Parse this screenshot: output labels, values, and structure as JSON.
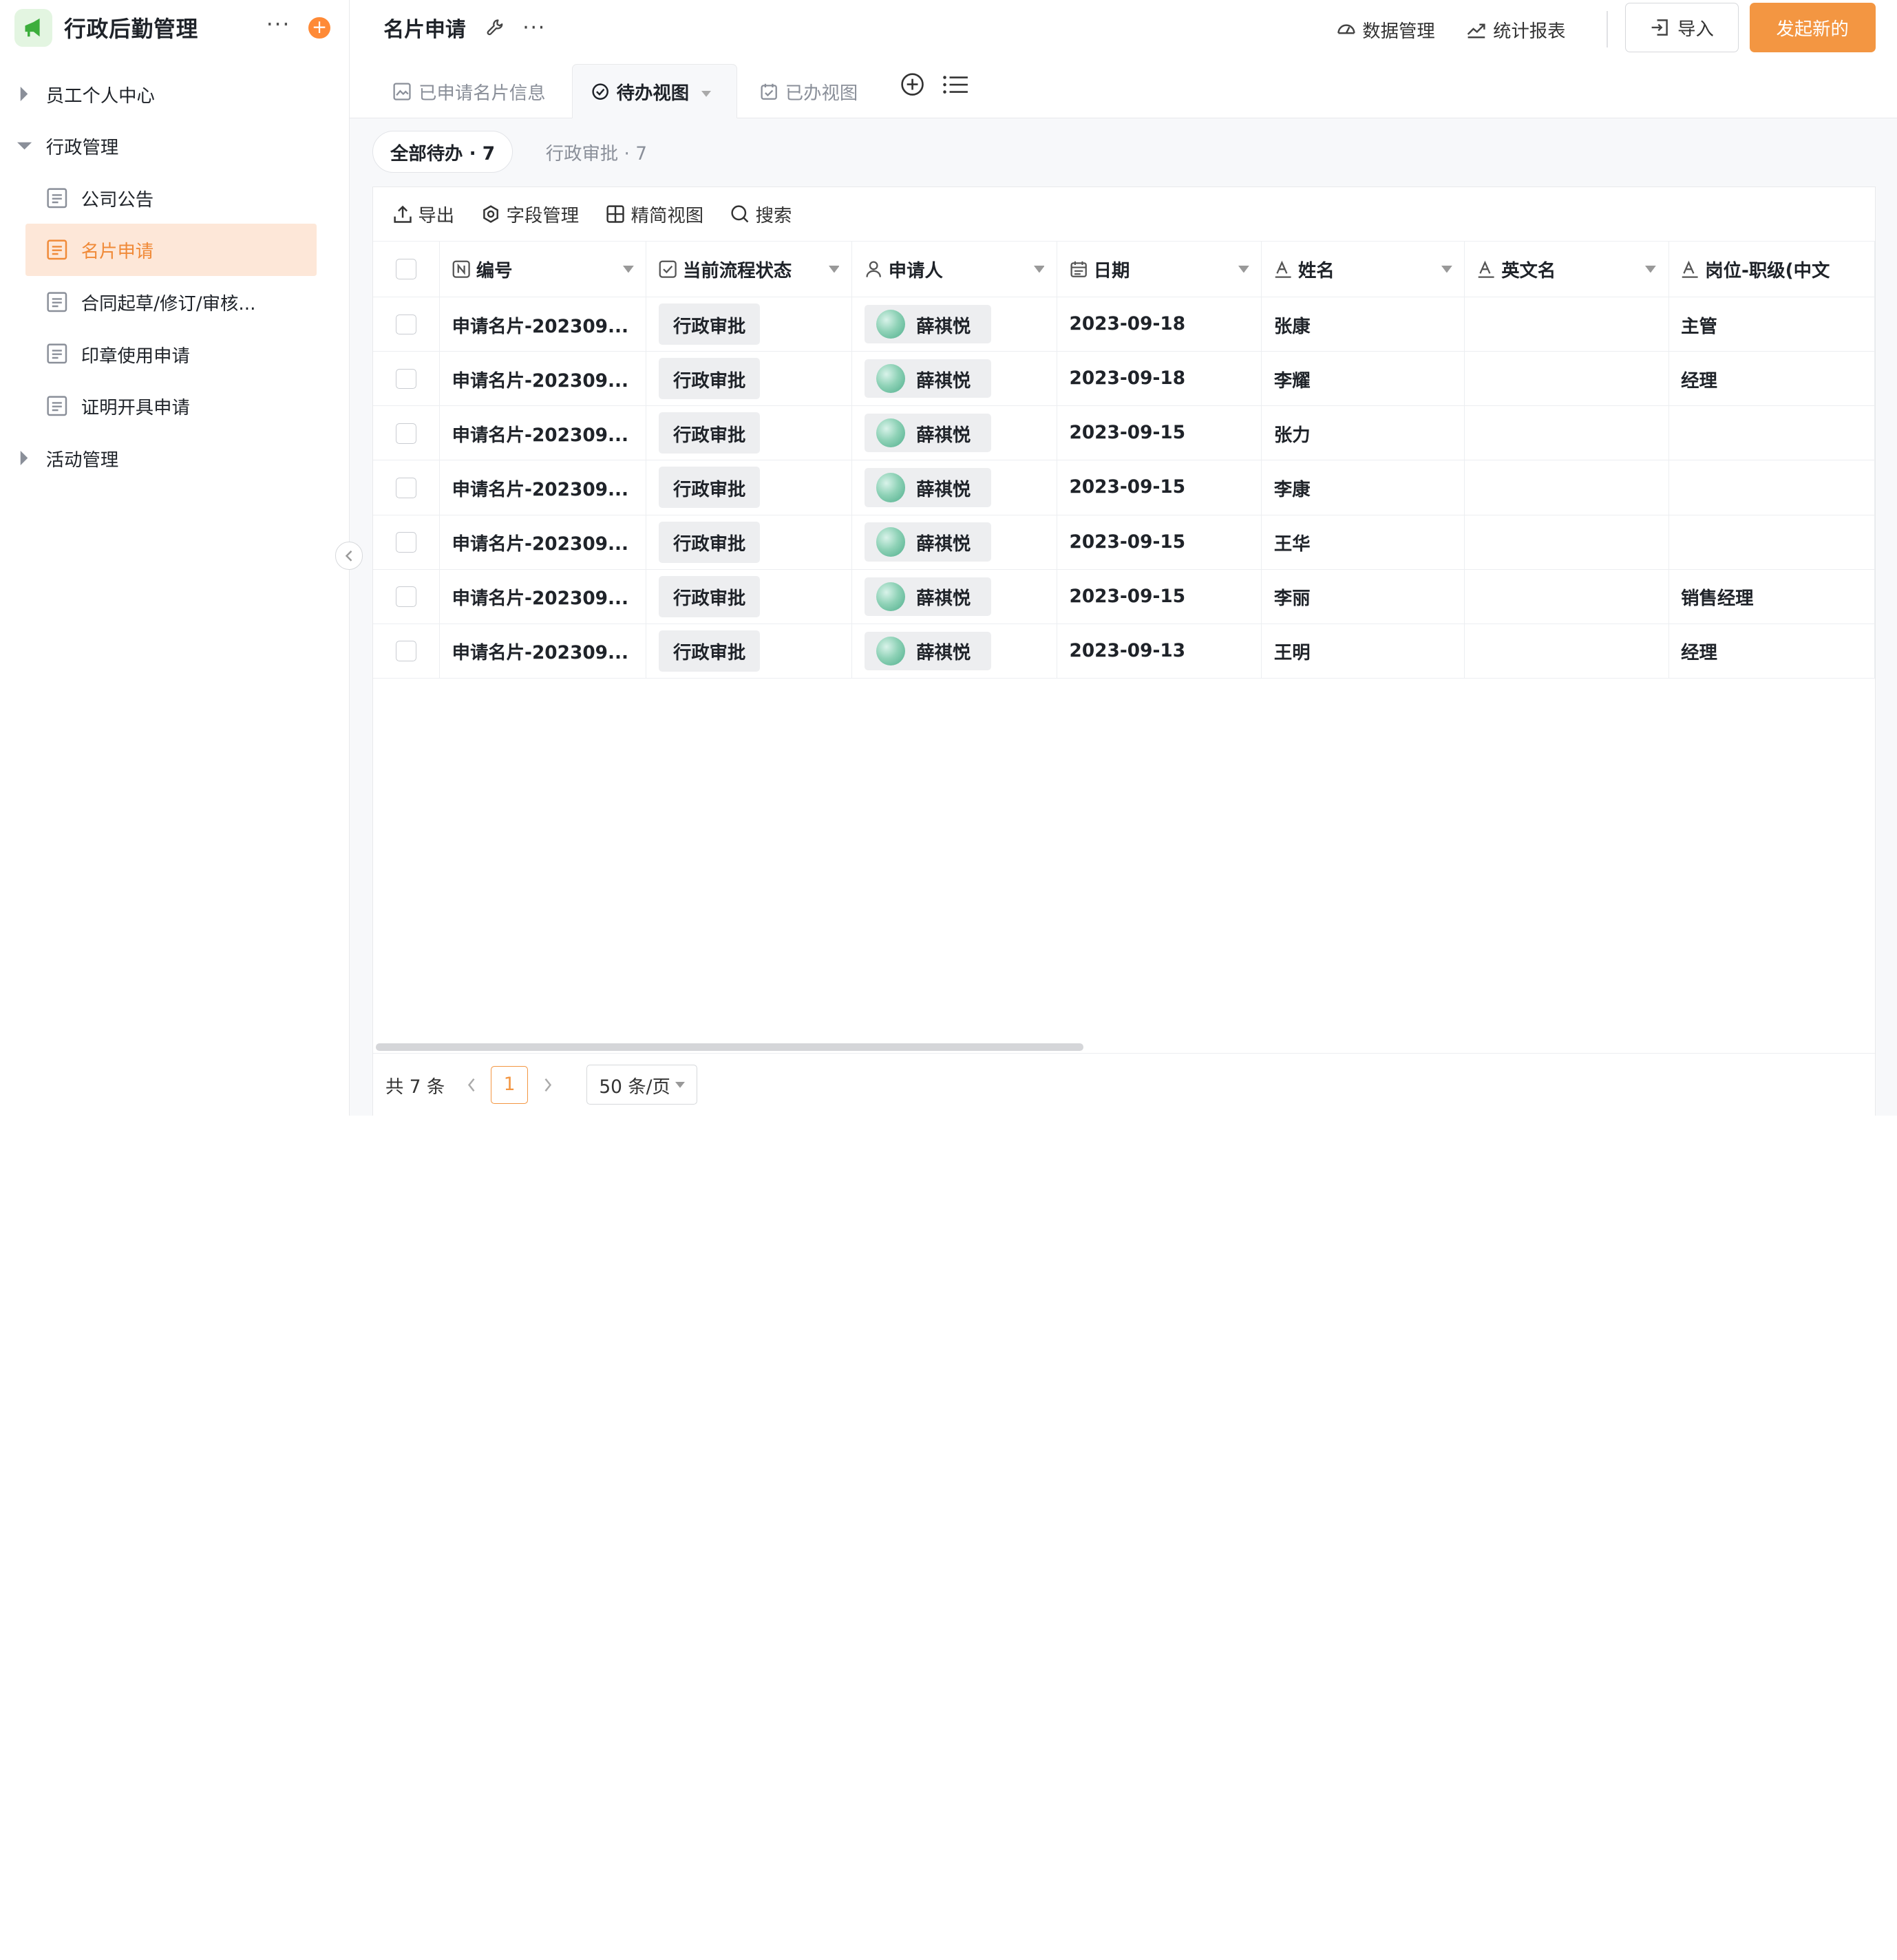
{
  "app": {
    "title": "行政后勤管理",
    "more": "···",
    "add": "+"
  },
  "sidebar": {
    "groups": [
      {
        "label": "员工个人中心",
        "expanded": false
      },
      {
        "label": "行政管理",
        "expanded": true
      },
      {
        "label": "活动管理",
        "expanded": false
      }
    ],
    "items": [
      {
        "label": "公司公告",
        "active": false
      },
      {
        "label": "名片申请",
        "active": true
      },
      {
        "label": "合同起草/修订/审核...",
        "active": false
      },
      {
        "label": "印章使用申请",
        "active": false
      },
      {
        "label": "证明开具申请",
        "active": false
      }
    ]
  },
  "header": {
    "title": "名片申请",
    "more": "···",
    "data_mgmt": "数据管理",
    "stats": "统计报表",
    "import": "导入",
    "new": "发起新的"
  },
  "tabs": [
    {
      "label": "已申请名片信息",
      "active": false
    },
    {
      "label": "待办视图",
      "active": true
    },
    {
      "label": "已办视图",
      "active": false
    }
  ],
  "filters": [
    {
      "label": "全部待办 · 7",
      "active": true
    },
    {
      "label": "行政审批 · 7",
      "active": false
    }
  ],
  "toolbar": {
    "export": "导出",
    "fields": "字段管理",
    "compact": "精简视图",
    "search": "搜索"
  },
  "table": {
    "columns": [
      "编号",
      "当前流程状态",
      "申请人",
      "日期",
      "姓名",
      "英文名",
      "岗位-职级(中文"
    ],
    "rows": [
      {
        "id": "申请名片-202309...",
        "status": "行政审批",
        "applicant": "薛祺悦",
        "date": "2023-09-18",
        "name": "张康",
        "en": "",
        "position": "主管"
      },
      {
        "id": "申请名片-202309...",
        "status": "行政审批",
        "applicant": "薛祺悦",
        "date": "2023-09-18",
        "name": "李耀",
        "en": "",
        "position": "经理"
      },
      {
        "id": "申请名片-202309...",
        "status": "行政审批",
        "applicant": "薛祺悦",
        "date": "2023-09-15",
        "name": "张力",
        "en": "",
        "position": ""
      },
      {
        "id": "申请名片-202309...",
        "status": "行政审批",
        "applicant": "薛祺悦",
        "date": "2023-09-15",
        "name": "李康",
        "en": "",
        "position": ""
      },
      {
        "id": "申请名片-202309...",
        "status": "行政审批",
        "applicant": "薛祺悦",
        "date": "2023-09-15",
        "name": "王华",
        "en": "",
        "position": ""
      },
      {
        "id": "申请名片-202309...",
        "status": "行政审批",
        "applicant": "薛祺悦",
        "date": "2023-09-15",
        "name": "李丽",
        "en": "",
        "position": "销售经理"
      },
      {
        "id": "申请名片-202309...",
        "status": "行政审批",
        "applicant": "薛祺悦",
        "date": "2023-09-13",
        "name": "王明",
        "en": "",
        "position": "经理"
      }
    ]
  },
  "pagination": {
    "total": "共 7 条",
    "current": "1",
    "page_size": "50 条/页"
  },
  "colors": {
    "accent": "#f39642",
    "active_bg": "#fde7d8",
    "logo_bg": "#e3f5e1",
    "logo_fg": "#3cae3c"
  }
}
